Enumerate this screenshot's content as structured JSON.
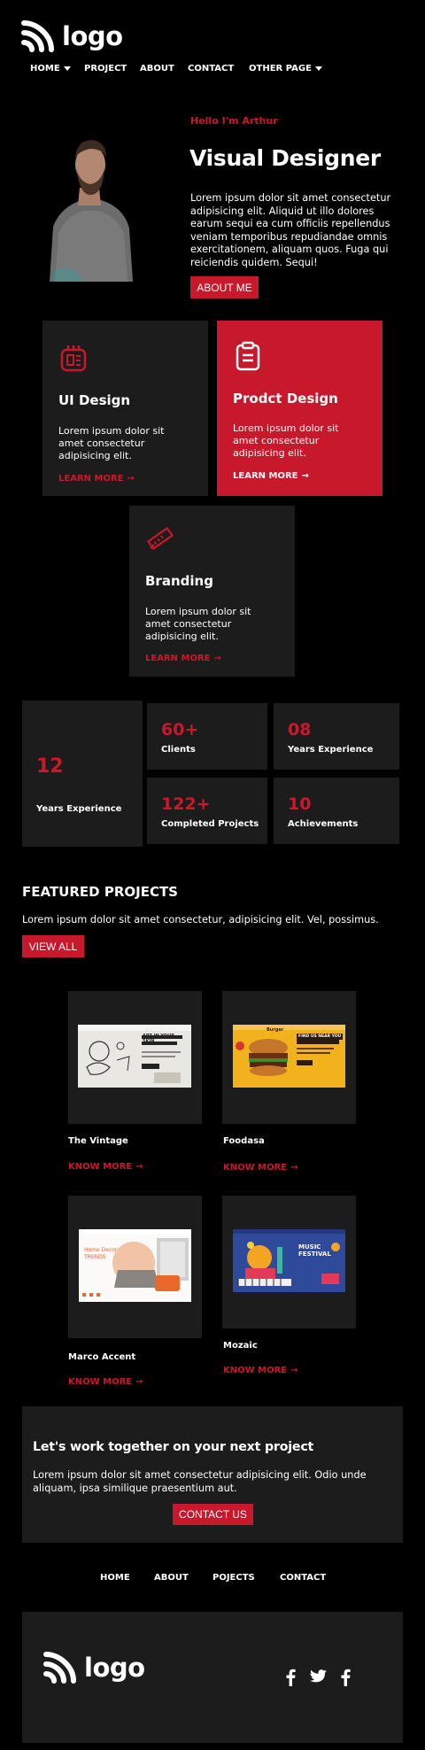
{
  "header": {
    "logo_text": "logo",
    "nav": [
      {
        "label": "HOME",
        "has_caret": true
      },
      {
        "label": "PROJECT",
        "has_caret": false
      },
      {
        "label": "ABOUT",
        "has_caret": false
      },
      {
        "label": "CONTACT",
        "has_caret": false
      },
      {
        "label": "OTHER PAGE",
        "has_caret": true
      }
    ]
  },
  "hero": {
    "greeting": "Hello I'm Arthur",
    "title": "Visual Designer",
    "description": "Lorem ipsum dolor sit amet consectetur adipisicing elit. Aliquid ut illo dolores earum sequi ea cum officiis repellendus veniam temporibus repudiandae omnis exercitationem, aliquam quos. Fuga qui reiciendis quidem. Sequi!",
    "button": "ABOUT ME"
  },
  "services": [
    {
      "title": "UI Design",
      "text": "Lorem ipsum dolor sit amet consectetur adipisicing elit.",
      "link": "LEARN MORE",
      "icon": "device-icon"
    },
    {
      "title": "Prodct Design",
      "text": "Lorem ipsum dolor sit amet consectetur adipisicing elit.",
      "link": "LEARN MORE",
      "icon": "clipboard-icon"
    },
    {
      "title": "Branding",
      "text": "Lorem ipsum dolor sit amet consectetur adipisicing elit.",
      "link": "LEARN MORE",
      "icon": "ruler-pencil-icon"
    }
  ],
  "stats": {
    "big": {
      "value": "12",
      "label": "Years Experience"
    },
    "items": [
      {
        "value": "60+",
        "label": "Clients"
      },
      {
        "value": "08",
        "label": "Years Experience"
      },
      {
        "value": "122+",
        "label": "Completed Projects"
      },
      {
        "value": "10",
        "label": "Achievements"
      }
    ]
  },
  "featured": {
    "title": "FEATURED PROJECTS",
    "text": "Lorem ipsum dolor sit amet consectetur, adipisicing elit. Vel, possimus.",
    "button": "VIEW ALL",
    "projects": [
      {
        "name": "The Vintage",
        "link": "KNOW MORE",
        "thumb_title": "ART IN YOUR SKIN"
      },
      {
        "name": "Foodasa",
        "link": "KNOW MORE",
        "thumb_title": "FIND US NEAR YOU",
        "thumb_brand": "Burger"
      },
      {
        "name": "Marco Accent",
        "link": "KNOW MORE",
        "thumb_title": "Home Decor TRENDS"
      },
      {
        "name": "Mozaic",
        "link": "KNOW MORE",
        "thumb_title": "MUSIC FESTIVAL"
      }
    ]
  },
  "cta": {
    "title": "Let's work together on your next project",
    "text": "Lorem ipsum dolor sit amet consectetur adipisicing elit. Odio unde aliquam, ipsa similique praesentium aut.",
    "button": "CONTACT US"
  },
  "footer": {
    "nav": [
      "HOME",
      "ABOUT",
      "POJECTS",
      "CONTACT"
    ],
    "logo_text": "logo",
    "social": [
      "facebook-icon",
      "twitter-icon",
      "facebook-icon"
    ]
  },
  "colors": {
    "accent": "#c8182b",
    "card": "#1c1c1c",
    "background": "#000000"
  }
}
